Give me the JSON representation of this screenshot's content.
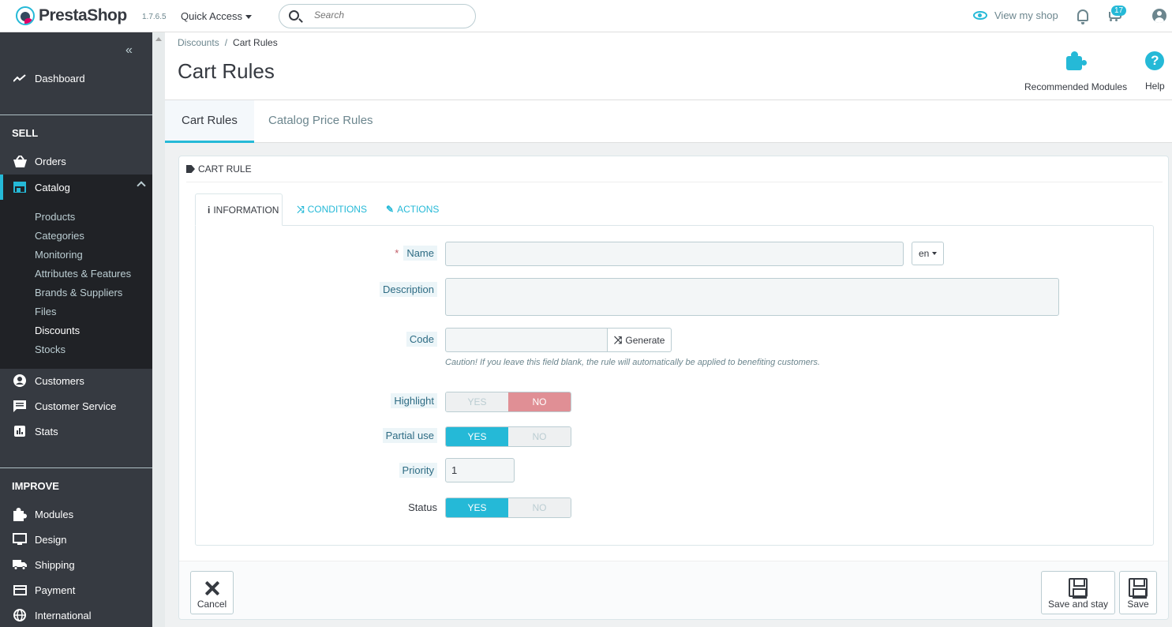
{
  "header": {
    "brand": "PrestaShop",
    "version": "1.7.6.5",
    "quick_access": "Quick Access",
    "search_placeholder": "Search",
    "view_shop": "View my shop",
    "cart_badge": "17"
  },
  "sidebar": {
    "collapse": "«",
    "dashboard": "Dashboard",
    "sections": {
      "sell": "SELL",
      "improve": "IMPROVE"
    },
    "sell_items": [
      "Orders",
      "Catalog"
    ],
    "catalog_sub": [
      "Products",
      "Categories",
      "Monitoring",
      "Attributes & Features",
      "Brands & Suppliers",
      "Files",
      "Discounts",
      "Stocks"
    ],
    "more_items": [
      "Customers",
      "Customer Service",
      "Stats"
    ],
    "improve_items": [
      "Modules",
      "Design",
      "Shipping",
      "Payment",
      "International"
    ]
  },
  "page": {
    "breadcrumb": [
      "Discounts",
      "Cart Rules"
    ],
    "breadcrumb_sep": "/",
    "title": "Cart Rules",
    "tools": {
      "modules": "Recommended Modules",
      "help": "Help",
      "help_glyph": "?"
    }
  },
  "tabs": [
    "Cart Rules",
    "Catalog Price Rules"
  ],
  "panel": {
    "heading": "CART RULE",
    "form_tabs": [
      "INFORMATION",
      "CONDITIONS",
      "ACTIONS"
    ],
    "fields": {
      "name_label": "Name",
      "required_mark": "*",
      "lang": "en",
      "description_label": "Description",
      "code_label": "Code",
      "generate": "Generate",
      "code_help": "Caution! If you leave this field blank, the rule will automatically be applied to benefiting customers.",
      "highlight_label": "Highlight",
      "partial_label": "Partial use",
      "priority_label": "Priority",
      "priority_value": "1",
      "status_label": "Status",
      "yes": "YES",
      "no": "NO"
    },
    "switches": {
      "highlight": "NO",
      "partial_use": "YES",
      "status": "YES"
    },
    "footer": {
      "cancel": "Cancel",
      "save_stay": "Save and stay",
      "save": "Save"
    }
  },
  "colors": {
    "accent": "#25b9d7",
    "sidebar": "#363a41",
    "no_active": "#e08f95"
  }
}
